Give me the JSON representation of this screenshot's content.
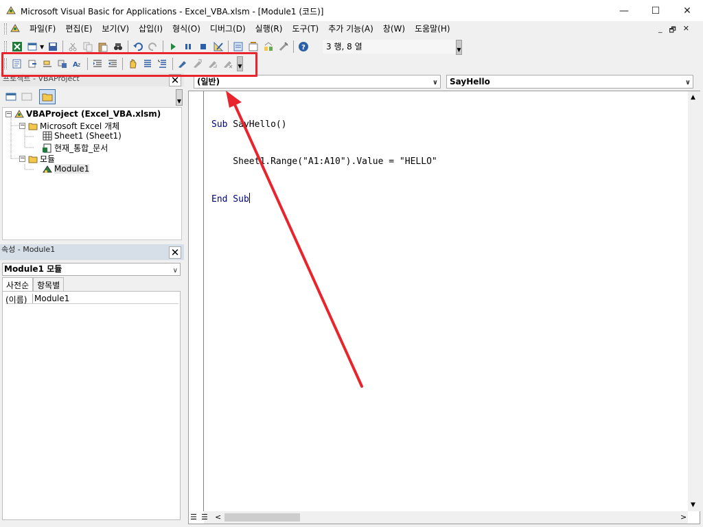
{
  "window": {
    "title": "Microsoft Visual Basic for Applications - Excel_VBA.xlsm - [Module1 (코드)]",
    "minimize": "—",
    "maximize": "☐",
    "close": "✕"
  },
  "menu": [
    "파일(F)",
    "편집(E)",
    "보기(V)",
    "삽입(I)",
    "형식(O)",
    "디버그(D)",
    "실행(R)",
    "도구(T)",
    "추가 기능(A)",
    "창(W)",
    "도움말(H)"
  ],
  "mdi": {
    "minimize": "_",
    "restore": "🗗",
    "close": "✕"
  },
  "toolbar": {
    "position": "3 행, 8 열"
  },
  "project": {
    "header": "프로젝트 - VBAProject",
    "close": "✕",
    "tree": {
      "root": "VBAProject (Excel_VBA.xlsm)",
      "folder_objects": "Microsoft Excel 개체",
      "sheet1": "Sheet1 (Sheet1)",
      "workbook": "현재_통합_문서",
      "folder_modules": "모듈",
      "module1": "Module1"
    }
  },
  "properties": {
    "header": "속성 - Module1",
    "close": "✕",
    "selected_object": "Module1 모듈",
    "tabs": [
      "사전순",
      "항목별"
    ],
    "rows": [
      {
        "key": "(이름)",
        "value": "Module1"
      }
    ]
  },
  "code": {
    "object_combo": "(일반)",
    "proc_combo": "SayHello",
    "lines": [
      "Sub SayHello()",
      "    Sheet1.Range(\"A1:A10\").Value = \"HELLO\"",
      "End Sub"
    ]
  },
  "colors": {
    "highlight": "#e8242d",
    "arrow": "#e8242d",
    "keyword": "#00007f"
  }
}
